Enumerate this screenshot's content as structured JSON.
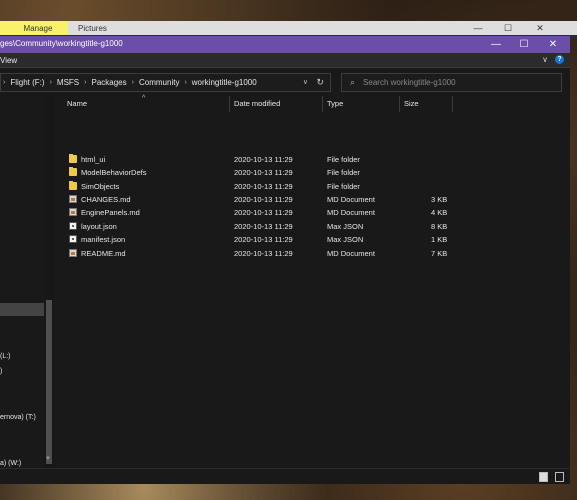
{
  "background_window": {
    "ribbon_tab_manage": "Manage",
    "ribbon_tab_pictures": "Pictures",
    "minimize_glyph": "—",
    "maximize_glyph": "☐",
    "close_glyph": "✕"
  },
  "window": {
    "title": "ges\\Community\\workingtitle-g1000",
    "minimize_glyph": "—",
    "maximize_glyph": "☐",
    "close_glyph": "✕",
    "accent_color": "#6b4ea8"
  },
  "ribbon": {
    "view_label": "View",
    "expand_glyph": "∨",
    "help_glyph": "?"
  },
  "address_bar": {
    "breadcrumbs": [
      "Flight (F:)",
      "MSFS",
      "Packages",
      "Community",
      "workingtitle-g1000"
    ],
    "separator": "›",
    "dropdown_glyph": "∨",
    "refresh_glyph": "↻"
  },
  "search": {
    "placeholder": "Search workingtitle-g1000",
    "icon": "search-icon"
  },
  "nav_pane": {
    "items": [
      "(L:)",
      ")",
      "ernova) (T:)",
      "a) (W:)",
      ":)"
    ]
  },
  "columns": {
    "name": "Name",
    "date_modified": "Date modified",
    "type": "Type",
    "size": "Size"
  },
  "files": [
    {
      "name": "html_ui",
      "date": "2020-10-13 11:29",
      "type": "File folder",
      "size": "",
      "icon": "folder-icon"
    },
    {
      "name": "ModelBehaviorDefs",
      "date": "2020-10-13 11:29",
      "type": "File folder",
      "size": "",
      "icon": "folder-icon"
    },
    {
      "name": "SimObjects",
      "date": "2020-10-13 11:29",
      "type": "File folder",
      "size": "",
      "icon": "folder-icon"
    },
    {
      "name": "CHANGES.md",
      "date": "2020-10-13 11:29",
      "type": "MD Document",
      "size": "3 KB",
      "icon": "markdown-file-icon"
    },
    {
      "name": "EnginePanels.md",
      "date": "2020-10-13 11:29",
      "type": "MD Document",
      "size": "4 KB",
      "icon": "markdown-file-icon"
    },
    {
      "name": "layout.json",
      "date": "2020-10-13 11:29",
      "type": "Max JSON",
      "size": "8 KB",
      "icon": "json-file-icon"
    },
    {
      "name": "manifest.json",
      "date": "2020-10-13 11:29",
      "type": "Max JSON",
      "size": "1 KB",
      "icon": "json-file-icon"
    },
    {
      "name": "README.md",
      "date": "2020-10-13 11:29",
      "type": "MD Document",
      "size": "7 KB",
      "icon": "markdown-file-icon"
    }
  ]
}
